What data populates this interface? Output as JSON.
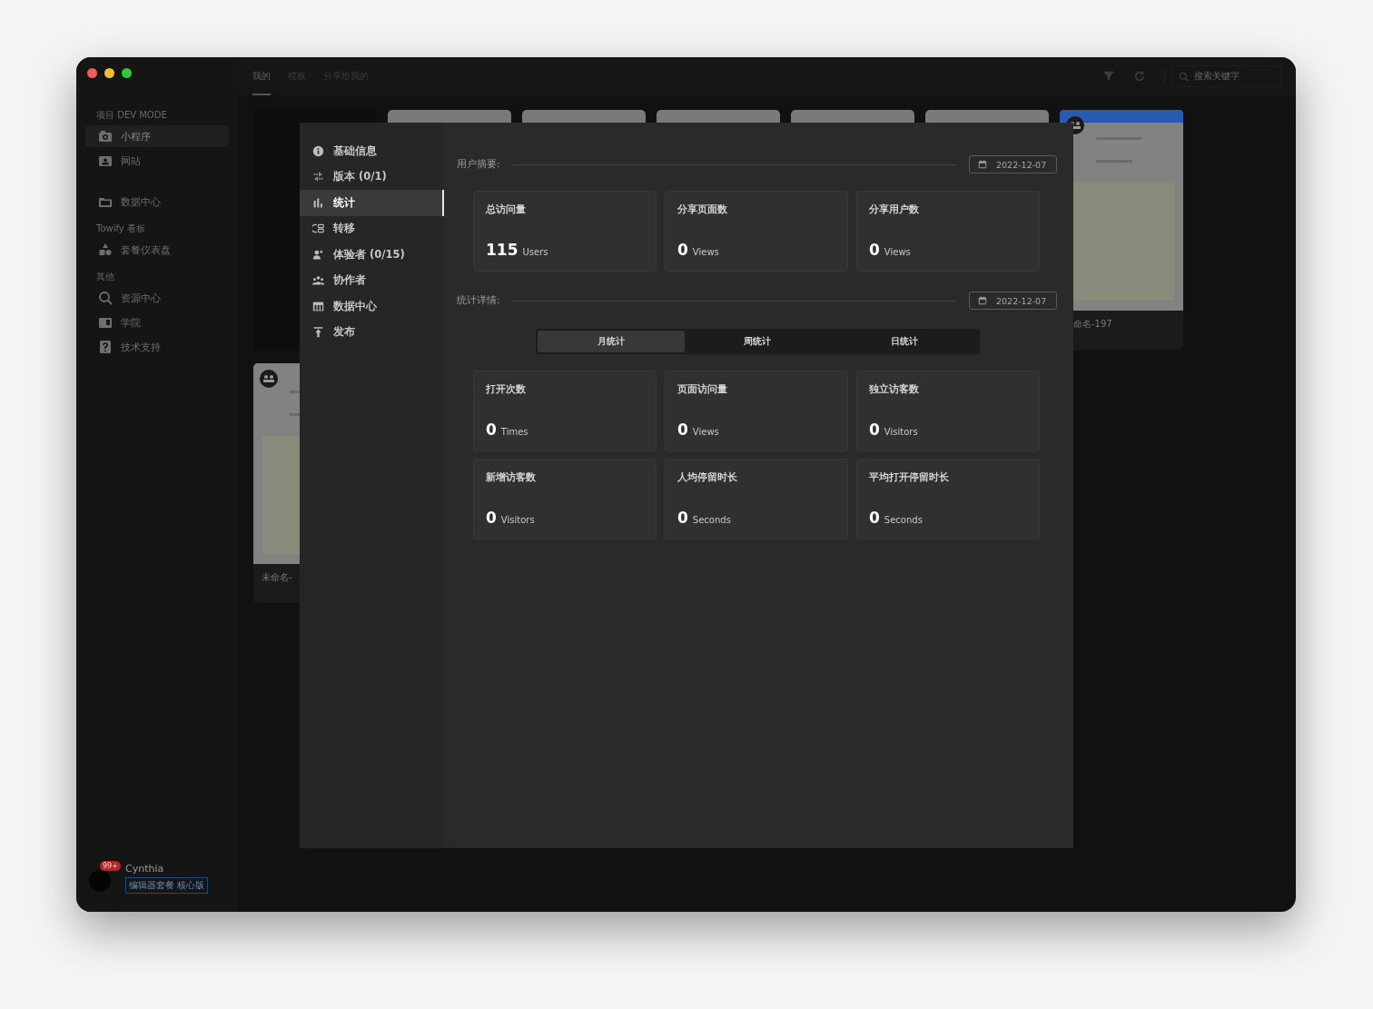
{
  "window": {
    "controls": [
      {
        "color": "#ec5f57"
      },
      {
        "color": "#f4bd2f"
      },
      {
        "color": "#2dc840"
      }
    ]
  },
  "sidebar": {
    "groups": [
      {
        "header": "项目 DEV MODE",
        "items": [
          {
            "label": "小程序",
            "selected": true
          },
          {
            "label": "网站",
            "selected": false
          }
        ]
      },
      {
        "items": [
          {
            "label": "数据中心",
            "selected": false
          }
        ]
      },
      {
        "header": "Towify 看板",
        "items": [
          {
            "label": "套餐仪表盘",
            "selected": false
          }
        ]
      },
      {
        "header": "其他",
        "items": [
          {
            "label": "资源中心",
            "selected": false
          },
          {
            "label": "学院",
            "selected": false
          },
          {
            "label": "技术支持",
            "selected": false
          }
        ]
      }
    ],
    "user": {
      "name": "Cynthia",
      "badge": "99+",
      "plan": "编辑器套餐 核心版"
    }
  },
  "tabs": [
    {
      "label": "我的",
      "selected": true
    },
    {
      "label": "模板",
      "selected": false
    },
    {
      "label": "分享给我的",
      "selected": false
    }
  ],
  "search": {
    "placeholder": "搜索关键字"
  },
  "projects": [
    {
      "kind": "dark"
    },
    {
      "kind": "gray"
    },
    {
      "kind": "gray"
    },
    {
      "kind": "gray"
    },
    {
      "kind": "gray"
    },
    {
      "kind": "gray"
    },
    {
      "kind": "preview",
      "title": "命名-197"
    },
    {
      "kind": "preview",
      "title": "未命名-"
    }
  ],
  "dialog": {
    "nav": [
      {
        "label": "基础信息",
        "selected": false
      },
      {
        "label": "版本 (0/1)",
        "selected": false
      },
      {
        "label": "统计",
        "selected": true
      },
      {
        "label": "转移",
        "selected": false
      },
      {
        "label": "体验者 (0/15)",
        "selected": false
      },
      {
        "label": "协作者",
        "selected": false
      },
      {
        "label": "数据中心",
        "selected": false
      },
      {
        "label": "发布",
        "selected": false
      }
    ],
    "summary": {
      "title": "用户摘要:",
      "date": "2022-12-07",
      "stats": [
        {
          "label": "总访问量",
          "value": "115",
          "unit": "Users"
        },
        {
          "label": "分享页面数",
          "value": "0",
          "unit": "Views"
        },
        {
          "label": "分享用户数",
          "value": "0",
          "unit": "Views"
        }
      ]
    },
    "details": {
      "title": "统计详情:",
      "date": "2022-12-07",
      "segments": [
        {
          "label": "月统计",
          "selected": true
        },
        {
          "label": "周统计",
          "selected": false
        },
        {
          "label": "日统计",
          "selected": false
        }
      ],
      "stats": [
        {
          "label": "打开次数",
          "value": "0",
          "unit": "Times"
        },
        {
          "label": "页面访问量",
          "value": "0",
          "unit": "Views"
        },
        {
          "label": "独立访客数",
          "value": "0",
          "unit": "Visitors"
        },
        {
          "label": "新增访客数",
          "value": "0",
          "unit": "Visitors"
        },
        {
          "label": "人均停留时长",
          "value": "0",
          "unit": "Seconds"
        },
        {
          "label": "平均打开停留时长",
          "value": "0",
          "unit": "Seconds"
        }
      ]
    }
  }
}
